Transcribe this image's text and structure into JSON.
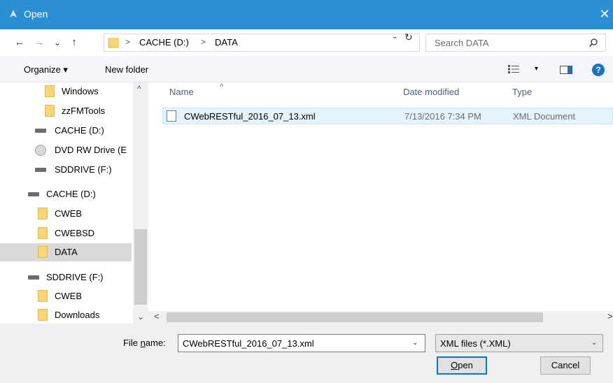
{
  "window": {
    "title": "Open",
    "close_glyph": "✕"
  },
  "nav": {
    "back_glyph": "←",
    "forward_glyph": "→",
    "recent_glyph": "⌄",
    "up_glyph": "↑",
    "refresh_glyph": "↻",
    "dropdown_glyph": "⌄"
  },
  "address": {
    "crumbs": [
      "CACHE (D:)",
      "DATA"
    ],
    "separator": ">"
  },
  "search": {
    "placeholder": "Search DATA"
  },
  "toolbar": {
    "organize_label": "Organize ▾",
    "new_folder_label": "New folder",
    "view_dropdown_glyph": "▾",
    "help_glyph": "?"
  },
  "sidebar": {
    "items": [
      {
        "label": "Windows",
        "icon": "folder-icon"
      },
      {
        "label": "zzFMTools",
        "icon": "folder-icon"
      },
      {
        "label": "CACHE (D:)",
        "icon": "drive-icon"
      },
      {
        "label": "DVD RW Drive (E",
        "icon": "disc-icon"
      },
      {
        "label": "SDDRIVE (F:)",
        "icon": "drive-icon"
      },
      {
        "label": "CACHE (D:)",
        "icon": "drive-icon"
      },
      {
        "label": "CWEB",
        "icon": "folder-icon"
      },
      {
        "label": "CWEBSD",
        "icon": "folder-icon"
      },
      {
        "label": "DATA",
        "icon": "folder-icon",
        "selected": true
      },
      {
        "label": "SDDRIVE (F:)",
        "icon": "drive-icon"
      },
      {
        "label": "CWEB",
        "icon": "folder-icon"
      },
      {
        "label": "Downloads",
        "icon": "folder-icon"
      }
    ],
    "scroll_up_glyph": "^",
    "scroll_down_glyph": "⌄"
  },
  "filelist": {
    "columns": [
      "Name",
      "Date modified",
      "Type"
    ],
    "sort_glyph": "^",
    "rows": [
      {
        "name": "CWebRESTful_2016_07_13.xml",
        "date": "7/13/2016 7:34 PM",
        "type": "XML Document"
      }
    ],
    "scroll_left_glyph": "<",
    "scroll_right_glyph": ">"
  },
  "footer": {
    "file_name_label_pre": "File ",
    "file_name_label_underline": "n",
    "file_name_label_post": "ame:",
    "file_name_value": "CWebRESTful_2016_07_13.xml",
    "file_type_value": "XML files (*.XML)",
    "dropdown_glyph": "⌄",
    "open_label_underline": "O",
    "open_label_rest": "pen",
    "cancel_label": "Cancel"
  },
  "colors": {
    "titlebar": "#2b8fd6",
    "selection": "#e5f3ff",
    "folder": "#f8d673",
    "accent": "#0078d7"
  }
}
